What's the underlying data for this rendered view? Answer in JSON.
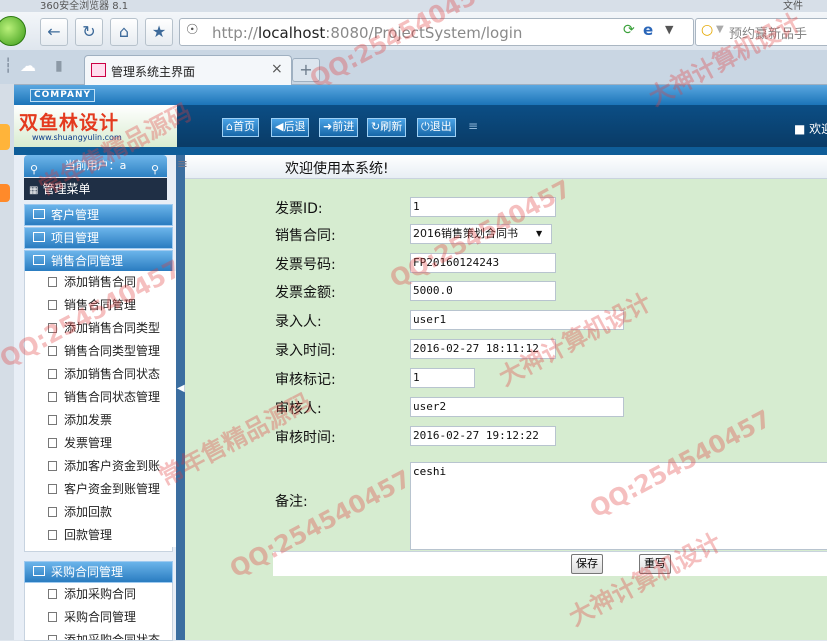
{
  "browser": {
    "window_title": "360安全浏览器 8.1",
    "window_menu": "文件",
    "address": {
      "protocol": "http://",
      "host": "localhost",
      "rest": ":8080/ProjectSystem/login"
    },
    "search_placeholder": "预约赢新品手",
    "tab_title": "管理系统主界面",
    "tab_close": "×",
    "new_tab": "+"
  },
  "header": {
    "company_label": "COMPANY",
    "brand_name": "双鱼林设计",
    "brand_url": "www.shuangyulin.com",
    "menu": [
      {
        "label": "首页",
        "icon": "home-icon"
      },
      {
        "label": "后退",
        "icon": "arrow-left-icon"
      },
      {
        "label": "前进",
        "icon": "arrow-right-icon"
      },
      {
        "label": "刷新",
        "icon": "refresh-icon"
      },
      {
        "label": "退出",
        "icon": "power-icon"
      }
    ],
    "welcome_right": "■ 欢迎"
  },
  "sidebar": {
    "current_user": "当前用户：a",
    "menu_title": "管理菜单",
    "groups": [
      {
        "label": "客户管理"
      },
      {
        "label": "项目管理"
      },
      {
        "label": "销售合同管理"
      },
      {
        "label": "采购合同管理"
      }
    ],
    "sales_items": [
      "添加销售合同",
      "销售合同管理",
      "添加销售合同类型",
      "销售合同类型管理",
      "添加销售合同状态",
      "销售合同状态管理",
      "添加发票",
      "发票管理",
      "添加客户资金到账",
      "客户资金到账管理",
      "添加回款",
      "回款管理"
    ],
    "purchase_items": [
      "添加采购合同",
      "采购合同管理",
      "添加采购合同状态"
    ]
  },
  "main": {
    "title": "欢迎使用本系统!",
    "fields": {
      "invoice_id": {
        "label": "发票ID:",
        "value": "1"
      },
      "sales_contract": {
        "label": "销售合同:",
        "value": "2016销售策划合同书"
      },
      "invoice_no": {
        "label": "发票号码:",
        "value": "FP20160124243"
      },
      "amount": {
        "label": "发票金额:",
        "value": "5000.0"
      },
      "entered_by": {
        "label": "录入人:",
        "value": "user1"
      },
      "entry_time": {
        "label": "录入时间:",
        "value": "2016-02-27 18:11:12"
      },
      "audit_flag": {
        "label": "审核标记:",
        "value": "1"
      },
      "auditor": {
        "label": "审核人:",
        "value": "user2"
      },
      "audit_time": {
        "label": "审核时间:",
        "value": "2016-02-27 19:12:22"
      },
      "remark": {
        "label": "备注:",
        "value": "ceshi"
      }
    },
    "save_label": "保存",
    "reset_label": "重写"
  },
  "watermarks": {
    "qq": "QQ:254540457",
    "design": "大神计算机设计",
    "source": "常年售精品源码"
  }
}
